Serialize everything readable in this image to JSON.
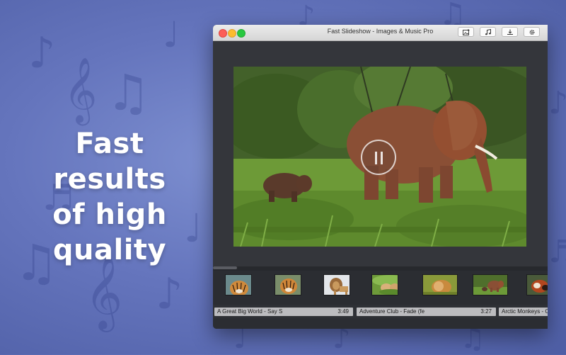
{
  "headline": {
    "lines": [
      "Fast results",
      "of high",
      "quality"
    ]
  },
  "window": {
    "title": "Fast Slideshow - Images & Music Pro",
    "toolbar": {
      "buttons": [
        {
          "name": "add-image",
          "icon": "image-plus-icon"
        },
        {
          "name": "music",
          "icon": "music-note-icon"
        },
        {
          "name": "export",
          "icon": "download-icon"
        },
        {
          "name": "settings",
          "icon": "gear-icon"
        }
      ]
    },
    "preview": {
      "playback_state": "playing",
      "overlay_icon": "pause-icon"
    },
    "timeline": {
      "thumbnails": [
        "tiger",
        "tiger",
        "lion",
        "lion-cubs",
        "lion-cub",
        "elephants",
        "red-panda"
      ]
    },
    "audio_tracks": [
      {
        "name": "A Great Big World - Say S",
        "duration": "3:49"
      },
      {
        "name": "Adventure Club - Fade (fe",
        "duration": "3:27"
      },
      {
        "name": "Arctic Monkeys - C",
        "duration": ""
      }
    ]
  },
  "colors": {
    "background": "#6575bd",
    "window_bg": "#2e3035",
    "accent_close": "#fc5f57",
    "accent_min": "#fdbc2e",
    "accent_max": "#28c840"
  }
}
